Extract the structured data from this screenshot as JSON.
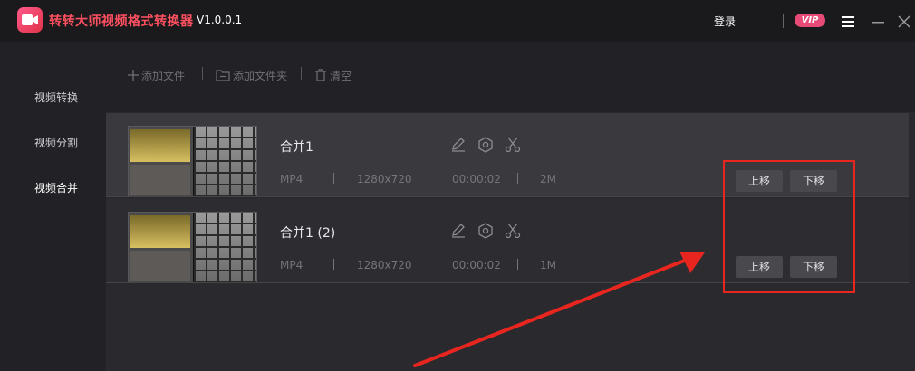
{
  "titlebar": {
    "title": "转转大师视频格式转换器",
    "version": "V1.0.0.1",
    "login_label": "登录",
    "vip_label": "VIP"
  },
  "sidebar": {
    "items": [
      {
        "label": "视频转换"
      },
      {
        "label": "视频分割"
      },
      {
        "label": "视频合并"
      }
    ]
  },
  "toolbar": {
    "add_file_label": "添加文件",
    "add_folder_label": "添加文件夹",
    "clear_label": "清空"
  },
  "files": [
    {
      "name": "合并1",
      "format": "MP4",
      "resolution": "1280x720",
      "duration": "00:00:02",
      "size": "2M",
      "up_label": "上移",
      "down_label": "下移"
    },
    {
      "name": "合并1 (2)",
      "format": "MP4",
      "resolution": "1280x720",
      "duration": "00:00:02",
      "size": "1M",
      "up_label": "上移",
      "down_label": "下移"
    }
  ],
  "colors": {
    "accent": "#ff5060",
    "vip": "#e84a78",
    "annotation": "#e8261f"
  }
}
